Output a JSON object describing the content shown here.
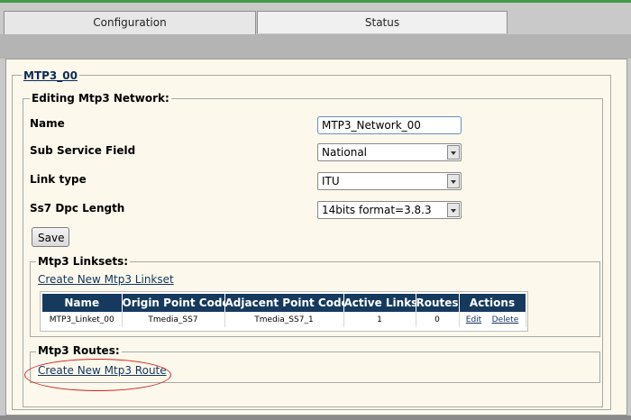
{
  "tabs": [
    {
      "label": "Configuration",
      "active": true
    },
    {
      "label": "Status",
      "active": false
    }
  ],
  "network": {
    "title": "MTP3_00",
    "editing_legend": "Editing Mtp3 Network:",
    "fields": {
      "name": {
        "label": "Name",
        "value": "MTP3_Network_00"
      },
      "sub_service_field": {
        "label": "Sub Service Field",
        "value": "National"
      },
      "link_type": {
        "label": "Link type",
        "value": "ITU"
      },
      "dpc_length": {
        "label": "Ss7 Dpc Length",
        "value": "14bits format=3.8.3"
      }
    },
    "save_label": "Save"
  },
  "linksets": {
    "legend": "Mtp3 Linksets:",
    "create_link": "Create New Mtp3 Linkset",
    "columns": [
      "Name",
      "Origin Point Code",
      "Adjacent Point Code",
      "Active Links",
      "Routes",
      "Actions"
    ],
    "rows": [
      {
        "name": "MTP3_Linket_00",
        "origin": "Tmedia_SS7",
        "adjacent": "Tmedia_SS7_1",
        "active_links": "1",
        "routes": "0",
        "edit": "Edit",
        "delete": "Delete"
      }
    ]
  },
  "routes": {
    "legend": "Mtp3 Routes:",
    "create_link": "Create New Mtp3 Route"
  },
  "colors": {
    "header_bg": "#163a5e",
    "content_bg": "#fcf9ec",
    "highlight": "#d42020"
  }
}
